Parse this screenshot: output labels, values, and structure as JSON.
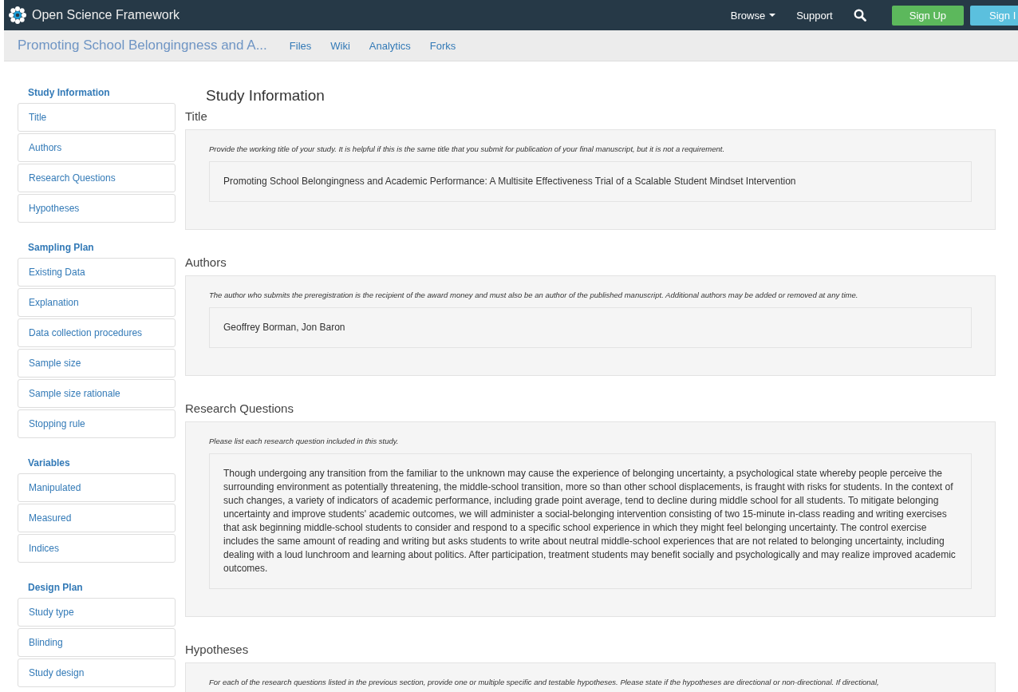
{
  "navbar": {
    "brand": "Open Science Framework",
    "links": [
      {
        "label": "Browse",
        "dropdown": true
      },
      {
        "label": "Support",
        "dropdown": false
      }
    ],
    "buttons": [
      {
        "label": "Sign Up",
        "kind": "signup"
      },
      {
        "label": "Sign I",
        "kind": "signin"
      }
    ]
  },
  "project_bar": {
    "title": "Promoting School Belongingness and A...",
    "links": [
      "Files",
      "Wiki",
      "Analytics",
      "Forks"
    ]
  },
  "sidebar": [
    {
      "heading": "Study Information",
      "items": [
        "Title",
        "Authors",
        "Research Questions",
        "Hypotheses"
      ]
    },
    {
      "heading": "Sampling Plan",
      "items": [
        "Existing Data",
        "Explanation",
        "Data collection procedures",
        "Sample size",
        "Sample size rationale",
        "Stopping rule"
      ]
    },
    {
      "heading": "Variables",
      "items": [
        "Manipulated",
        "Measured",
        "Indices"
      ]
    },
    {
      "heading": "Design Plan",
      "items": [
        "Study type",
        "Blinding",
        "Study design"
      ]
    }
  ],
  "page_title": "Study Information",
  "sections": [
    {
      "title": "Title",
      "help": "Provide the working title of your study. It is helpful if this is the same title that you submit for publication of your final manuscript, but it is not a requirement.",
      "answer": "Promoting School Belongingness and Academic Performance: A Multisite Effectiveness Trial of a Scalable Student Mindset Intervention"
    },
    {
      "title": "Authors",
      "help": "The author who submits the preregistration is the recipient of the award money and must also be an author of the published manuscript. Additional authors may be added or removed at any time.",
      "answer": "Geoffrey Borman, Jon Baron"
    },
    {
      "title": "Research Questions",
      "help": "Please list each research question included in this study.",
      "answer": "Though undergoing any transition from the familiar to the unknown may cause the experience of belonging uncertainty, a psychological state whereby people perceive the surrounding environment as potentially threatening, the middle-school transition, more so than other school displacements, is fraught with risks for students.  In the context of such changes, a variety of indicators of academic performance, including grade point average, tend to decline during middle school for all students.  To mitigate belonging uncertainty and improve students' academic outcomes, we will administer a social-belonging intervention consisting of two 15-minute in-class reading and writing exercises that ask beginning middle-school students to consider and respond to a specific school experience in which they might feel belonging uncertainty. The control exercise includes the same amount of reading and writing but asks students to write about neutral middle-school experiences that are not related to belonging uncertainty, including dealing with a loud lunchroom and learning about politics.  After participation, treatment students may benefit socially and psychologically and may realize improved academic outcomes."
    },
    {
      "title": "Hypotheses",
      "help": "For each of the research questions listed in the previous section, provide one or multiple specific and testable hypotheses. Please state if the hypotheses are directional or non-directional. If directional,"
    }
  ]
}
